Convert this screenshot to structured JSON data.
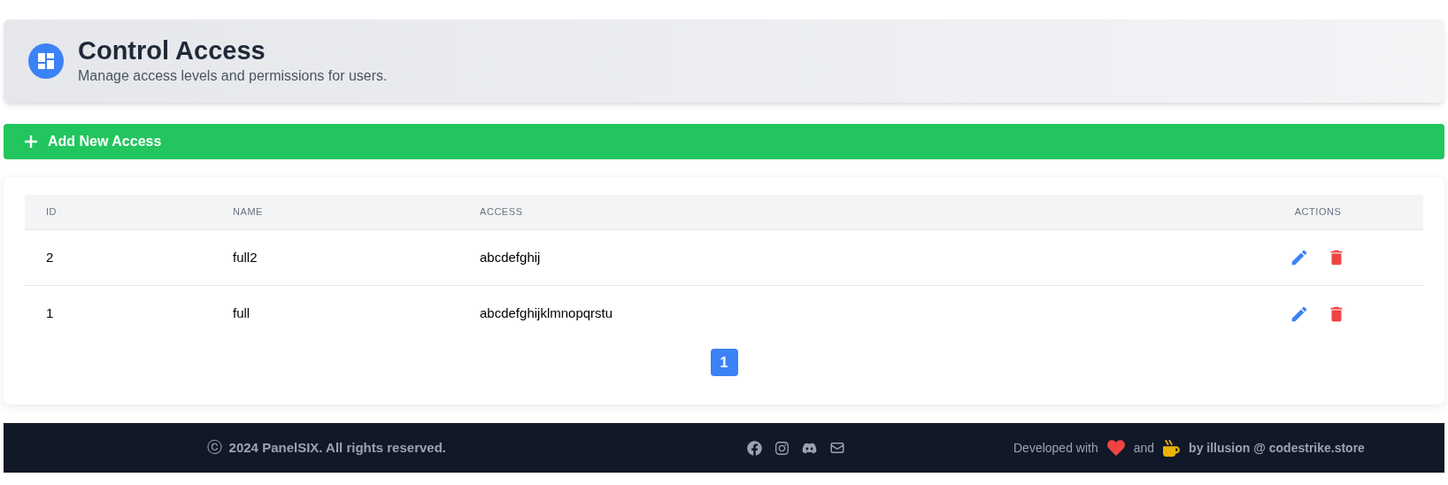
{
  "header": {
    "title": "Control Access",
    "subtitle": "Manage access levels and permissions for users."
  },
  "add_button": {
    "label": "Add New Access"
  },
  "table": {
    "columns": [
      "ID",
      "NAME",
      "ACCESS",
      "ACTIONS"
    ],
    "rows": [
      {
        "id": "2",
        "name": "full2",
        "access": "abcdefghij"
      },
      {
        "id": "1",
        "name": "full",
        "access": "abcdefghijklmnopqrstu"
      }
    ]
  },
  "pagination": [
    {
      "label": "1",
      "selected": true
    }
  ],
  "footer": {
    "copyright_symbol": "ⓒ",
    "copyright": "2024 PanelSIX. All rights reserved.",
    "developed": "Developed with",
    "and": "and",
    "by": "by illusion @ codestrike.store"
  }
}
